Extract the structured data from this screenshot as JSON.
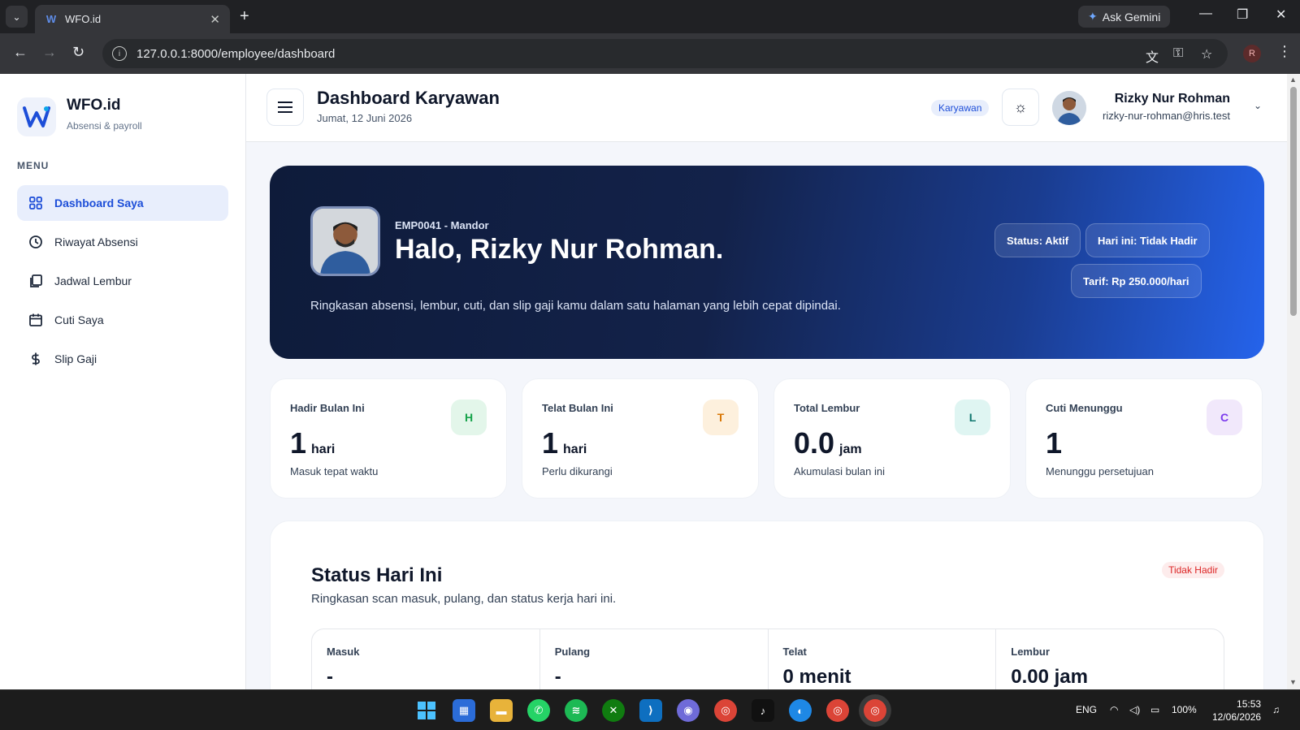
{
  "browser": {
    "tab_title": "WFO.id",
    "url": "127.0.0.1:8000/employee/dashboard",
    "gemini_label": "Ask Gemini",
    "profile_initial": "R"
  },
  "sidebar": {
    "brand": "WFO.id",
    "brand_sub": "Absensi & payroll",
    "menu_label": "MENU",
    "items": [
      {
        "label": "Dashboard Saya",
        "icon": "grid-icon",
        "active": true
      },
      {
        "label": "Riwayat Absensi",
        "icon": "clock-icon",
        "active": false
      },
      {
        "label": "Jadwal Lembur",
        "icon": "copy-icon",
        "active": false
      },
      {
        "label": "Cuti Saya",
        "icon": "calendar-icon",
        "active": false
      },
      {
        "label": "Slip Gaji",
        "icon": "dollar-icon",
        "active": false
      }
    ]
  },
  "header": {
    "title": "Dashboard Karyawan",
    "date": "Jumat, 12 Juni 2026",
    "role_badge": "Karyawan",
    "user_name": "Rizky Nur Rohman",
    "user_email": "rizky-nur-rohman@hris.test"
  },
  "hero": {
    "code": "EMP0041 - Mandor",
    "greeting": "Halo, Rizky Nur Rohman.",
    "description": "Ringkasan absensi, lembur, cuti, dan slip gaji kamu dalam satu halaman yang lebih cepat dipindai.",
    "pills": [
      "Status: Aktif",
      "Hari ini: Tidak Hadir",
      "Tarif: Rp 250.000/hari"
    ]
  },
  "stats": [
    {
      "label": "Hadir Bulan Ini",
      "value": "1",
      "unit": "hari",
      "sub": "Masuk tepat waktu",
      "icon": "H",
      "icon_bg": "#e3f6ea",
      "icon_color": "#16a34a"
    },
    {
      "label": "Telat Bulan Ini",
      "value": "1",
      "unit": "hari",
      "sub": "Perlu dikurangi",
      "icon": "T",
      "icon_bg": "#fdf0dd",
      "icon_color": "#d97706"
    },
    {
      "label": "Total Lembur",
      "value": "0.0",
      "unit": "jam",
      "sub": "Akumulasi bulan ini",
      "icon": "L",
      "icon_bg": "#dff5f2",
      "icon_color": "#0f766e"
    },
    {
      "label": "Cuti Menunggu",
      "value": "1",
      "unit": "",
      "sub": "Menunggu persetujuan",
      "icon": "C",
      "icon_bg": "#f1e8fb",
      "icon_color": "#7c3aed"
    }
  ],
  "status_today": {
    "title": "Status Hari Ini",
    "subtitle": "Ringkasan scan masuk, pulang, dan status kerja hari ini.",
    "badge": "Tidak Hadir",
    "cells": [
      {
        "label": "Masuk",
        "value": "-"
      },
      {
        "label": "Pulang",
        "value": "-"
      },
      {
        "label": "Telat",
        "value": "0 menit"
      },
      {
        "label": "Lembur",
        "value": "0.00 jam"
      }
    ]
  },
  "taskbar": {
    "lang": "ENG",
    "battery": "100%",
    "time": "15:53",
    "date": "12/06/2026"
  }
}
